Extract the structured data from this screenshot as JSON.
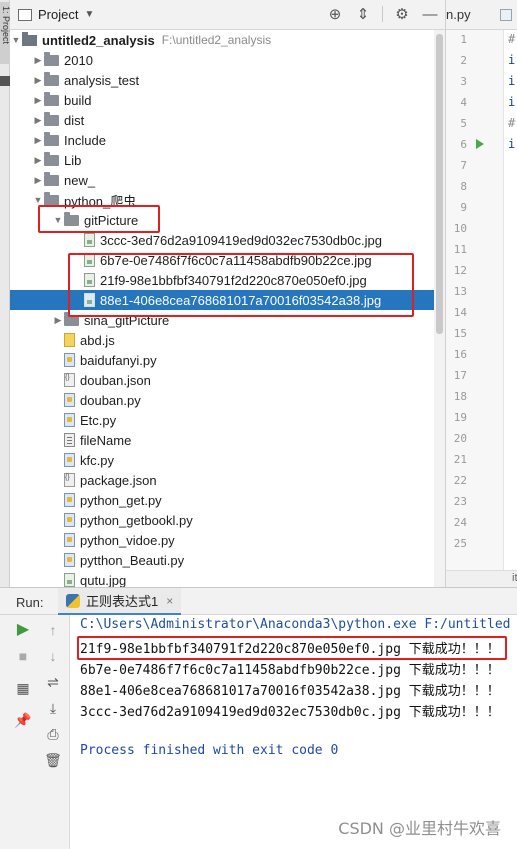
{
  "project_toolbar": {
    "title": "Project"
  },
  "editor": {
    "tab_label": "n.py",
    "line_numbers": [
      "1",
      "2",
      "3",
      "4",
      "5",
      "6",
      "7",
      "8",
      "9",
      "10",
      "11",
      "12",
      "13",
      "14",
      "15",
      "16",
      "17",
      "18",
      "19",
      "20",
      "21",
      "22",
      "23",
      "24",
      "25"
    ],
    "code_snippets": [
      "#",
      "i",
      "i",
      "i",
      "#",
      "i"
    ],
    "bottom_text": "it"
  },
  "left_strip": {
    "label": "1: Project"
  },
  "tree": {
    "root": {
      "name": "untitled2_analysis",
      "path": "F:\\untitled2_analysis"
    },
    "items": [
      {
        "name": "2010",
        "kind": "folder"
      },
      {
        "name": "analysis_test",
        "kind": "folder"
      },
      {
        "name": "build",
        "kind": "folder"
      },
      {
        "name": "dist",
        "kind": "folder"
      },
      {
        "name": "Include",
        "kind": "folder"
      },
      {
        "name": "Lib",
        "kind": "folder"
      },
      {
        "name": "new_",
        "kind": "folder"
      },
      {
        "name": "python_爬虫",
        "kind": "folder",
        "expanded": true
      },
      {
        "name": "gitPicture",
        "kind": "folder",
        "expanded": true
      },
      {
        "name": "3ccc-3ed76d2a9109419ed9d032ec7530db0c.jpg",
        "kind": "image"
      },
      {
        "name": "6b7e-0e7486f7f6c0c7a11458abdfb90b22ce.jpg",
        "kind": "image"
      },
      {
        "name": "21f9-98e1bbfbf340791f2d220c870e050ef0.jpg",
        "kind": "image"
      },
      {
        "name": "88e1-406e8cea768681017a70016f03542a38.jpg",
        "kind": "image",
        "selected": true
      },
      {
        "name": "sina_gitPicture",
        "kind": "folder"
      },
      {
        "name": "abd.js",
        "kind": "js"
      },
      {
        "name": "baidufanyi.py",
        "kind": "py"
      },
      {
        "name": "douban.json",
        "kind": "json"
      },
      {
        "name": "douban.py",
        "kind": "py"
      },
      {
        "name": "Etc.py",
        "kind": "py"
      },
      {
        "name": "fileName",
        "kind": "txt"
      },
      {
        "name": "kfc.py",
        "kind": "py"
      },
      {
        "name": "package.json",
        "kind": "json"
      },
      {
        "name": "python_get.py",
        "kind": "py"
      },
      {
        "name": "python_getbookl.py",
        "kind": "py"
      },
      {
        "name": "python_vidoe.py",
        "kind": "py"
      },
      {
        "name": "pytthon_Beauti.py",
        "kind": "py"
      },
      {
        "name": "qutu.jpg",
        "kind": "image"
      }
    ]
  },
  "run_panel": {
    "label": "Run:",
    "tab_name": "正则表达式1",
    "console": {
      "command": "C:\\Users\\Administrator\\Anaconda3\\python.exe F:/untitled",
      "lines": [
        {
          "file": "21f9-98e1bbfbf340791f2d220c870e050ef0.jpg",
          "msg": "下载成功！！！"
        },
        {
          "file": "6b7e-0e7486f7f6c0c7a11458abdfb90b22ce.jpg",
          "msg": "下载成功！！！"
        },
        {
          "file": "88e1-406e8cea768681017a70016f03542a38.jpg",
          "msg": "下载成功！！！"
        },
        {
          "file": "3ccc-3ed76d2a9109419ed9d032ec7530db0c.jpg",
          "msg": "下载成功！！！"
        }
      ],
      "exit": "Process finished with exit code 0"
    }
  },
  "watermark": "CSDN @业里村牛欢喜",
  "colors": {
    "selection": "#2675bf",
    "annotation_red": "#e02020",
    "console_path": "#1f4fa3",
    "run_green": "#4aa84a"
  }
}
